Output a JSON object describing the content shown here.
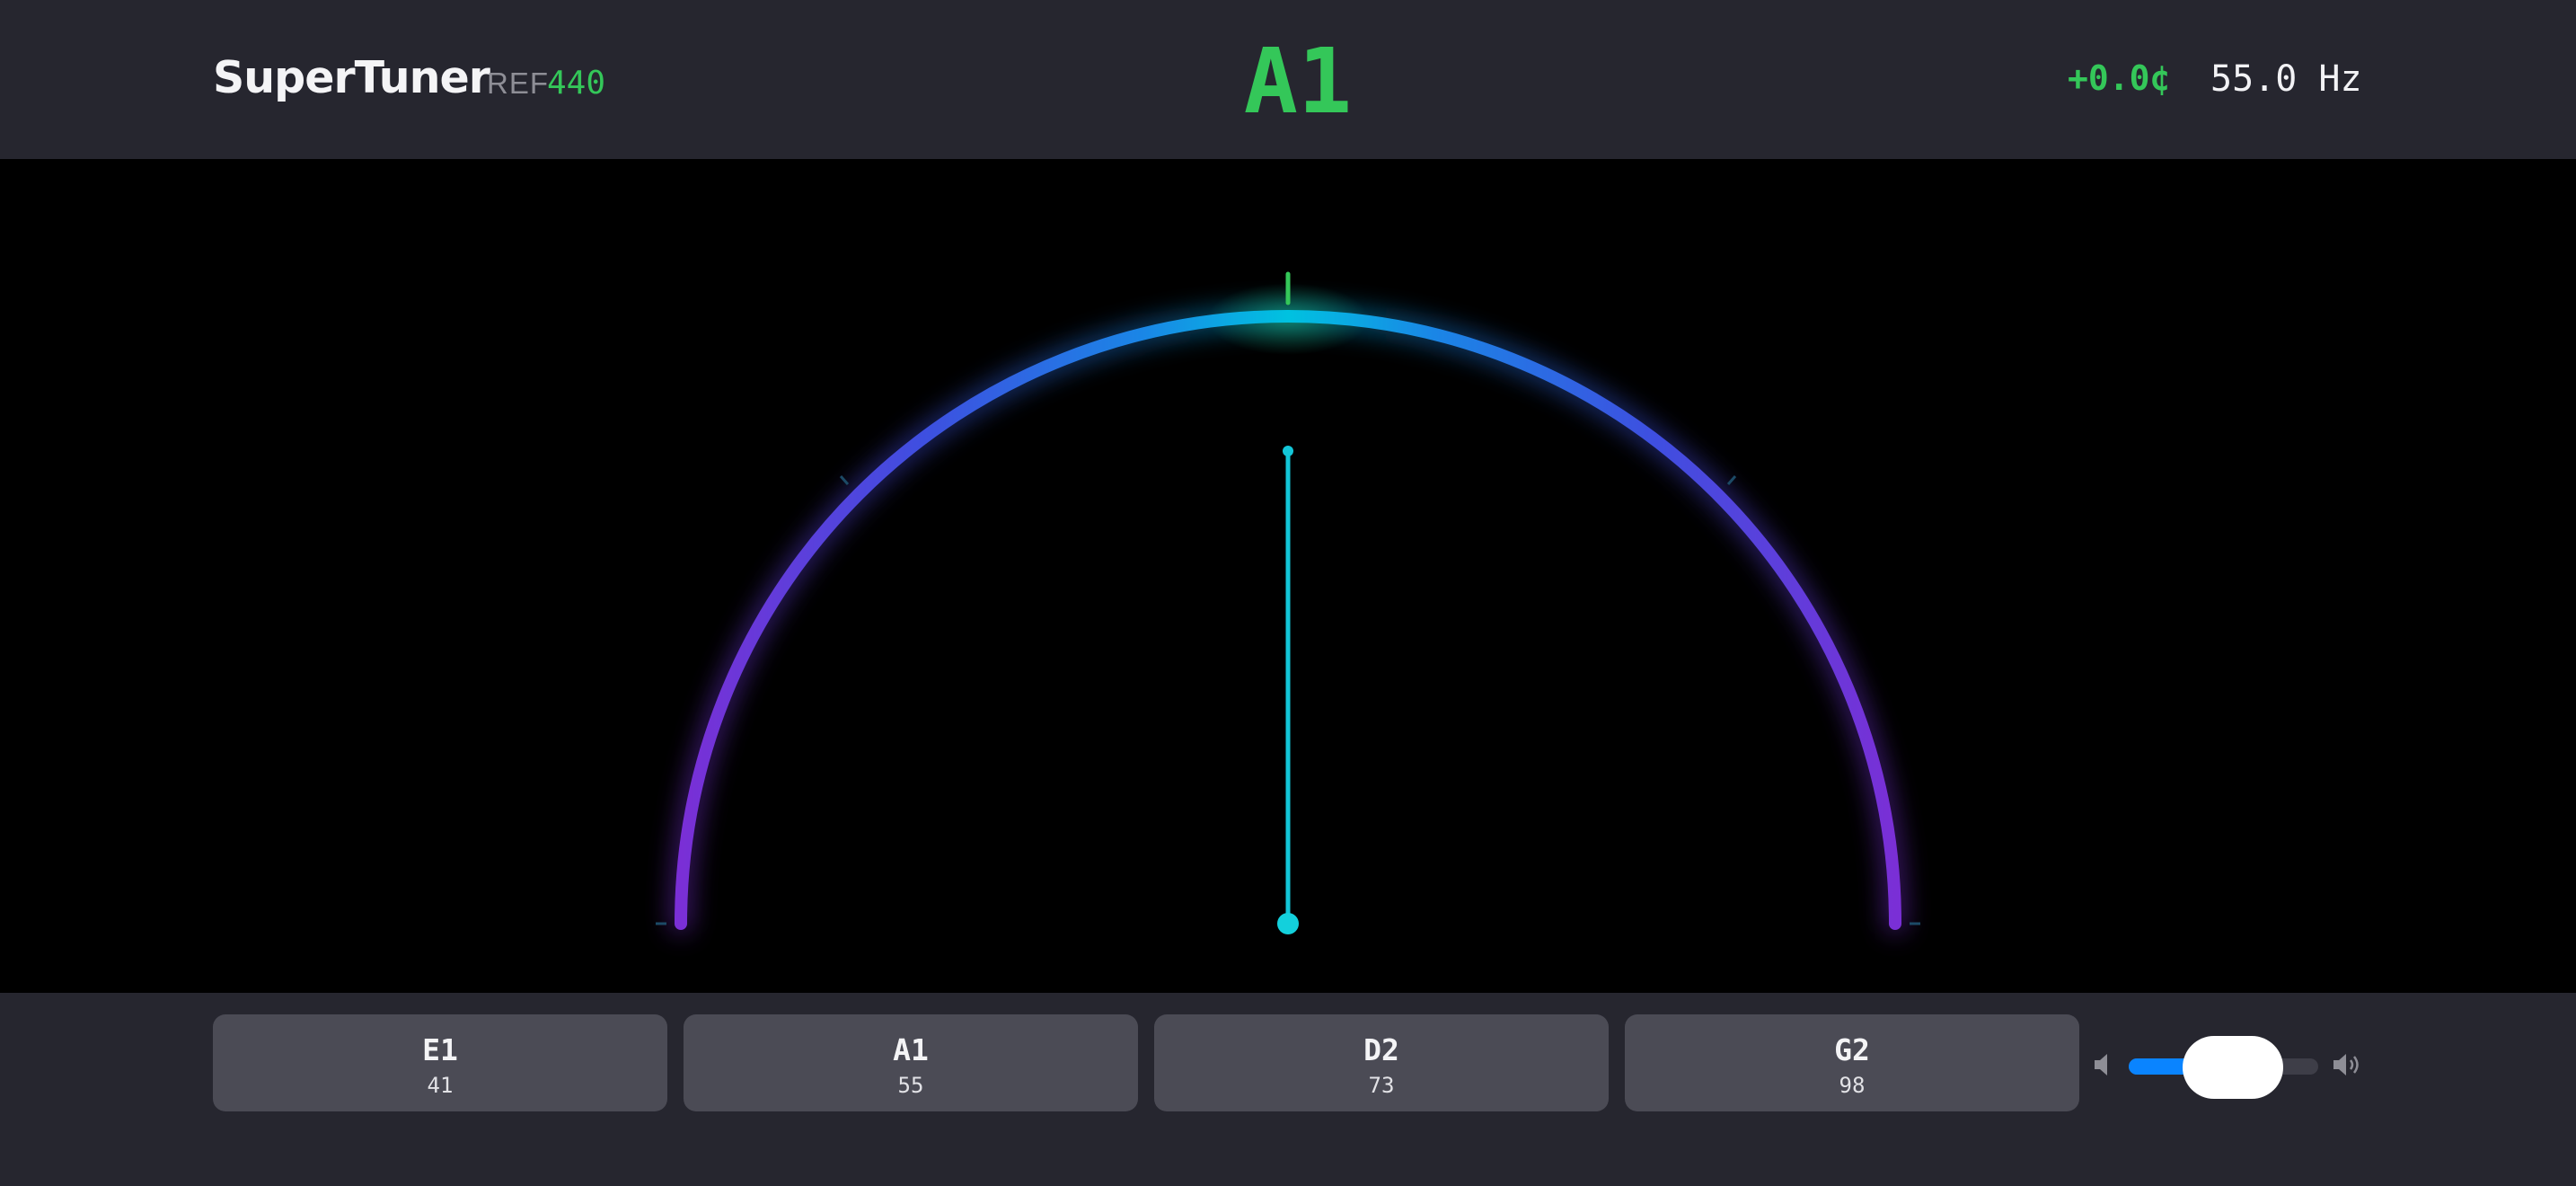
{
  "header": {
    "app_title": "SuperTuner",
    "ref_label": "REF",
    "ref_value": "440",
    "note": "A1",
    "cents": "+0.0¢",
    "frequency": "55.0 Hz"
  },
  "meter": {
    "cents_offset": 0.0,
    "range_cents": [
      -50,
      50
    ],
    "in_tune_color": "#34c759",
    "arc_gradient": [
      "#00c2e0",
      "#1f6fe6",
      "#7a2fd6"
    ],
    "needle_color": "#13c6d8"
  },
  "strings": [
    {
      "name": "E1",
      "number": "41"
    },
    {
      "name": "A1",
      "number": "55"
    },
    {
      "name": "D2",
      "number": "73"
    },
    {
      "name": "G2",
      "number": "98"
    }
  ],
  "volume": {
    "level": 0.55,
    "mute_icon": "speaker-mute-icon",
    "loud_icon": "speaker-loud-icon",
    "accent": "#0a84ff"
  }
}
